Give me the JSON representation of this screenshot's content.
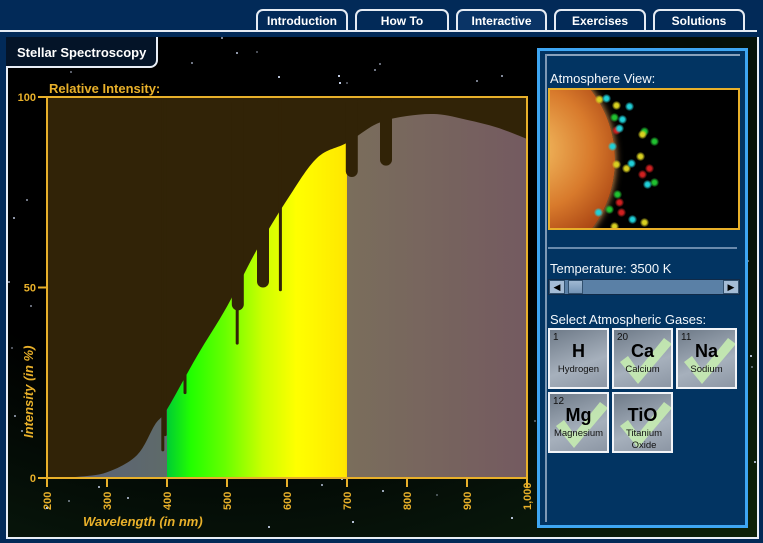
{
  "tabs": [
    {
      "label": "Introduction",
      "active": false
    },
    {
      "label": "How To",
      "active": false
    },
    {
      "label": "Interactive",
      "active": true
    },
    {
      "label": "Exercises",
      "active": false
    },
    {
      "label": "Solutions",
      "active": false
    }
  ],
  "module_title": "Stellar Spectroscopy",
  "chart_data": {
    "type": "area",
    "title": "Relative Intensity:",
    "xlabel": "Wavelength (in nm)",
    "ylabel": "Intensity (in %)",
    "xlim": [
      200,
      1000
    ],
    "ylim": [
      0,
      100
    ],
    "x_ticks": [
      200,
      300,
      400,
      500,
      600,
      700,
      800,
      900,
      1000
    ],
    "x_tick_labels": [
      "200",
      "300",
      "400",
      "500",
      "600",
      "700",
      "800",
      "900",
      "1,000"
    ],
    "y_ticks": [
      0,
      50,
      100
    ],
    "y_tick_labels": [
      "0",
      "50",
      "100"
    ],
    "grid": false,
    "visible_band_nm": [
      400,
      700
    ],
    "spectrum": {
      "x": [
        200,
        250,
        300,
        350,
        380,
        400,
        450,
        500,
        550,
        600,
        650,
        700,
        750,
        800,
        850,
        900,
        950,
        1000
      ],
      "y": [
        0,
        0.3,
        1.5,
        6,
        14,
        18,
        32,
        45,
        60,
        73,
        84,
        88,
        93,
        95,
        95.5,
        94,
        92,
        89
      ]
    },
    "absorption_lines": [
      {
        "nm": 393,
        "depth_to": 7,
        "width_nm": 2
      },
      {
        "nm": 397,
        "depth_to": 11,
        "width_nm": 2
      },
      {
        "nm": 430,
        "depth_to": 22,
        "width_nm": 2
      },
      {
        "nm": 517,
        "depth_to": 35,
        "width_nm": 4
      },
      {
        "nm": 518,
        "depth_to": 44,
        "width_nm": 20
      },
      {
        "nm": 560,
        "depth_to": 50,
        "width_nm": 20
      },
      {
        "nm": 589,
        "depth_to": 49,
        "width_nm": 3
      },
      {
        "nm": 708,
        "depth_to": 79,
        "width_nm": 20
      },
      {
        "nm": 765,
        "depth_to": 82,
        "width_nm": 20
      }
    ],
    "colors": {
      "background": "#312307",
      "axis": "#e8b02a",
      "uv": "#5a6478",
      "ir_start": "#7a6e5c",
      "ir_end": "#745a60"
    }
  },
  "panel": {
    "atmosphere_label": "Atmosphere View:",
    "temperature_label": "Temperature: 3500 K",
    "temperature_k": 3500,
    "temperature_fraction": 0.02,
    "gases_label": "Select Atmospheric Gases:",
    "gases": [
      {
        "number": "1",
        "symbol": "H",
        "name": "Hydrogen",
        "selected": false
      },
      {
        "number": "20",
        "symbol": "Ca",
        "name": "Calcium",
        "selected": true
      },
      {
        "number": "11",
        "symbol": "Na",
        "name": "Sodium",
        "selected": true
      },
      {
        "number": "12",
        "symbol": "Mg",
        "name": "Magnesium",
        "selected": true
      },
      {
        "number": "",
        "symbol": "TiO",
        "name": "Titanium Oxide",
        "selected": true
      }
    ],
    "scroll_left_icon": "◀",
    "scroll_right_icon": "▶"
  }
}
